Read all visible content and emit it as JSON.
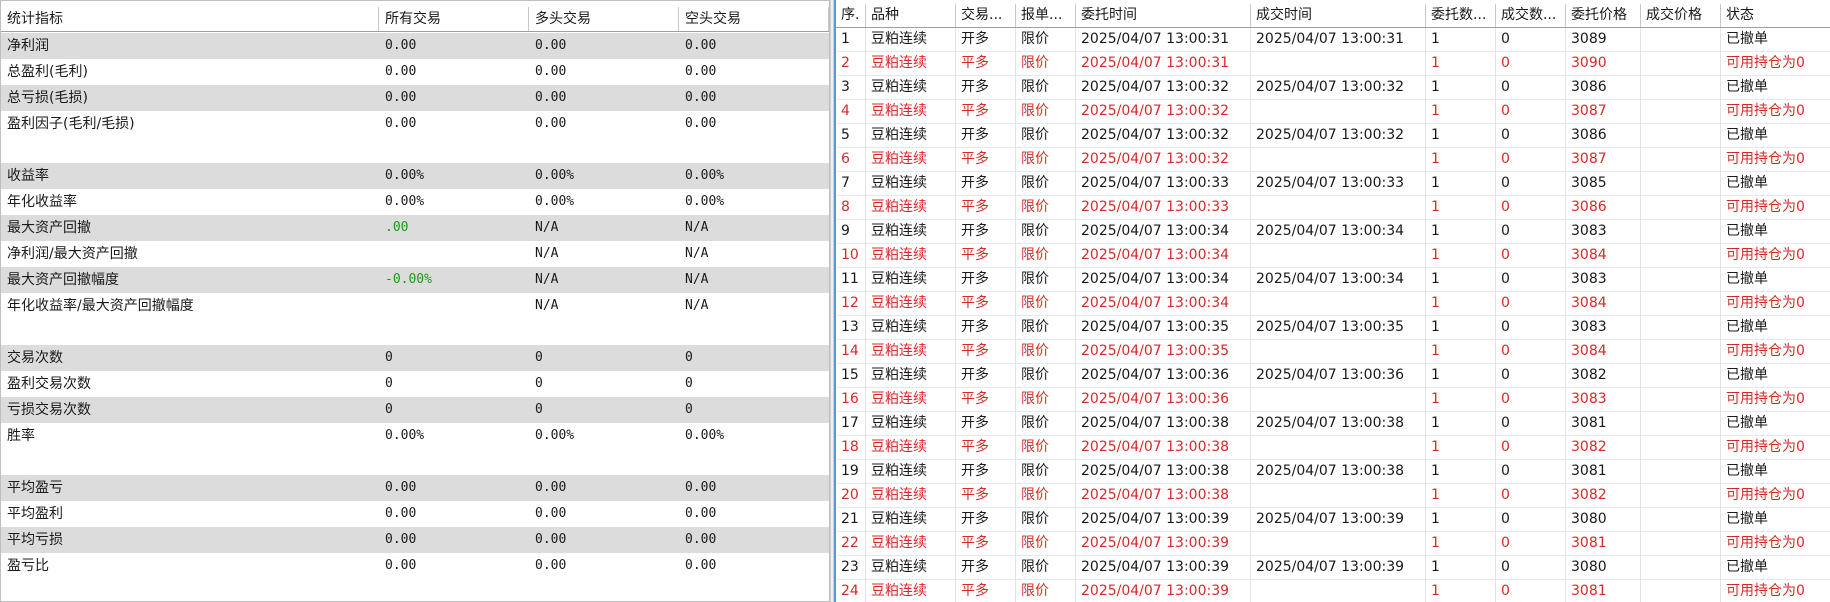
{
  "stats_panel": {
    "headers": [
      "统计指标",
      "所有交易",
      "多头交易",
      "空头交易"
    ],
    "rows": [
      {
        "name": "净利润",
        "all": "0.00",
        "long": "0.00",
        "short": "0.00"
      },
      {
        "name": "总盈利(毛利)",
        "all": "0.00",
        "long": "0.00",
        "short": "0.00"
      },
      {
        "name": "总亏损(毛损)",
        "all": "0.00",
        "long": "0.00",
        "short": "0.00"
      },
      {
        "name": "盈利因子(毛利/毛损)",
        "all": "0.00",
        "long": "0.00",
        "short": "0.00"
      },
      {
        "name": "收益率",
        "all": "0.00%",
        "long": "0.00%",
        "short": "0.00%"
      },
      {
        "name": "年化收益率",
        "all": "0.00%",
        "long": "0.00%",
        "short": "0.00%"
      },
      {
        "name": "最大资产回撤",
        "all": ".00",
        "long": "N/A",
        "short": "N/A",
        "all_color": "#1a9a1a"
      },
      {
        "name": "净利润/最大资产回撤",
        "all": "",
        "long": "N/A",
        "short": "N/A"
      },
      {
        "name": "最大资产回撤幅度",
        "all": "-0.00%",
        "long": "N/A",
        "short": "N/A",
        "all_color": "#1a9a1a"
      },
      {
        "name": "年化收益率/最大资产回撤幅度",
        "all": "",
        "long": "N/A",
        "short": "N/A"
      },
      {
        "name": "交易次数",
        "all": "0",
        "long": "0",
        "short": "0"
      },
      {
        "name": "盈利交易次数",
        "all": "0",
        "long": "0",
        "short": "0"
      },
      {
        "name": "亏损交易次数",
        "all": "0",
        "long": "0",
        "short": "0"
      },
      {
        "name": "胜率",
        "all": "0.00%",
        "long": "0.00%",
        "short": "0.00%"
      },
      {
        "name": "平均盈亏",
        "all": "0.00",
        "long": "0.00",
        "short": "0.00"
      },
      {
        "name": "平均盈利",
        "all": "0.00",
        "long": "0.00",
        "short": "0.00"
      },
      {
        "name": "平均亏损",
        "all": "0.00",
        "long": "0.00",
        "short": "0.00"
      },
      {
        "name": "盈亏比",
        "all": "0.00",
        "long": "0.00",
        "short": "0.00"
      }
    ]
  },
  "orders_panel": {
    "headers": [
      "序.",
      "品种",
      "交易...",
      "报单...",
      "委托时间",
      "成交时间",
      "委托数...",
      "成交数...",
      "委托价格",
      "成交价格",
      "状态"
    ],
    "colors": {
      "normal": "#1a1a1a",
      "highlight": "#d62a2a"
    },
    "rows": [
      {
        "seq": "1",
        "symbol": "豆粕连续",
        "trade": "开多",
        "order_type": "限价",
        "order_time": "2025/04/07 13:00:31",
        "fill_time": "2025/04/07 13:00:31",
        "order_qty": "1",
        "fill_qty": "0",
        "order_price": "3089",
        "fill_price": "",
        "status": "已撤单"
      },
      {
        "seq": "2",
        "symbol": "豆粕连续",
        "trade": "平多",
        "order_type": "限价",
        "order_time": "2025/04/07 13:00:31",
        "fill_time": "",
        "order_qty": "1",
        "fill_qty": "0",
        "order_price": "3090",
        "fill_price": "",
        "status": "可用持仓为0"
      },
      {
        "seq": "3",
        "symbol": "豆粕连续",
        "trade": "开多",
        "order_type": "限价",
        "order_time": "2025/04/07 13:00:32",
        "fill_time": "2025/04/07 13:00:32",
        "order_qty": "1",
        "fill_qty": "0",
        "order_price": "3086",
        "fill_price": "",
        "status": "已撤单"
      },
      {
        "seq": "4",
        "symbol": "豆粕连续",
        "trade": "平多",
        "order_type": "限价",
        "order_time": "2025/04/07 13:00:32",
        "fill_time": "",
        "order_qty": "1",
        "fill_qty": "0",
        "order_price": "3087",
        "fill_price": "",
        "status": "可用持仓为0"
      },
      {
        "seq": "5",
        "symbol": "豆粕连续",
        "trade": "开多",
        "order_type": "限价",
        "order_time": "2025/04/07 13:00:32",
        "fill_time": "2025/04/07 13:00:32",
        "order_qty": "1",
        "fill_qty": "0",
        "order_price": "3086",
        "fill_price": "",
        "status": "已撤单"
      },
      {
        "seq": "6",
        "symbol": "豆粕连续",
        "trade": "平多",
        "order_type": "限价",
        "order_time": "2025/04/07 13:00:32",
        "fill_time": "",
        "order_qty": "1",
        "fill_qty": "0",
        "order_price": "3087",
        "fill_price": "",
        "status": "可用持仓为0"
      },
      {
        "seq": "7",
        "symbol": "豆粕连续",
        "trade": "开多",
        "order_type": "限价",
        "order_time": "2025/04/07 13:00:33",
        "fill_time": "2025/04/07 13:00:33",
        "order_qty": "1",
        "fill_qty": "0",
        "order_price": "3085",
        "fill_price": "",
        "status": "已撤单"
      },
      {
        "seq": "8",
        "symbol": "豆粕连续",
        "trade": "平多",
        "order_type": "限价",
        "order_time": "2025/04/07 13:00:33",
        "fill_time": "",
        "order_qty": "1",
        "fill_qty": "0",
        "order_price": "3086",
        "fill_price": "",
        "status": "可用持仓为0"
      },
      {
        "seq": "9",
        "symbol": "豆粕连续",
        "trade": "开多",
        "order_type": "限价",
        "order_time": "2025/04/07 13:00:34",
        "fill_time": "2025/04/07 13:00:34",
        "order_qty": "1",
        "fill_qty": "0",
        "order_price": "3083",
        "fill_price": "",
        "status": "已撤单"
      },
      {
        "seq": "10",
        "symbol": "豆粕连续",
        "trade": "平多",
        "order_type": "限价",
        "order_time": "2025/04/07 13:00:34",
        "fill_time": "",
        "order_qty": "1",
        "fill_qty": "0",
        "order_price": "3084",
        "fill_price": "",
        "status": "可用持仓为0"
      },
      {
        "seq": "11",
        "symbol": "豆粕连续",
        "trade": "开多",
        "order_type": "限价",
        "order_time": "2025/04/07 13:00:34",
        "fill_time": "2025/04/07 13:00:34",
        "order_qty": "1",
        "fill_qty": "0",
        "order_price": "3083",
        "fill_price": "",
        "status": "已撤单"
      },
      {
        "seq": "12",
        "symbol": "豆粕连续",
        "trade": "平多",
        "order_type": "限价",
        "order_time": "2025/04/07 13:00:34",
        "fill_time": "",
        "order_qty": "1",
        "fill_qty": "0",
        "order_price": "3084",
        "fill_price": "",
        "status": "可用持仓为0"
      },
      {
        "seq": "13",
        "symbol": "豆粕连续",
        "trade": "开多",
        "order_type": "限价",
        "order_time": "2025/04/07 13:00:35",
        "fill_time": "2025/04/07 13:00:35",
        "order_qty": "1",
        "fill_qty": "0",
        "order_price": "3083",
        "fill_price": "",
        "status": "已撤单"
      },
      {
        "seq": "14",
        "symbol": "豆粕连续",
        "trade": "平多",
        "order_type": "限价",
        "order_time": "2025/04/07 13:00:35",
        "fill_time": "",
        "order_qty": "1",
        "fill_qty": "0",
        "order_price": "3084",
        "fill_price": "",
        "status": "可用持仓为0"
      },
      {
        "seq": "15",
        "symbol": "豆粕连续",
        "trade": "开多",
        "order_type": "限价",
        "order_time": "2025/04/07 13:00:36",
        "fill_time": "2025/04/07 13:00:36",
        "order_qty": "1",
        "fill_qty": "0",
        "order_price": "3082",
        "fill_price": "",
        "status": "已撤单"
      },
      {
        "seq": "16",
        "symbol": "豆粕连续",
        "trade": "平多",
        "order_type": "限价",
        "order_time": "2025/04/07 13:00:36",
        "fill_time": "",
        "order_qty": "1",
        "fill_qty": "0",
        "order_price": "3083",
        "fill_price": "",
        "status": "可用持仓为0"
      },
      {
        "seq": "17",
        "symbol": "豆粕连续",
        "trade": "开多",
        "order_type": "限价",
        "order_time": "2025/04/07 13:00:38",
        "fill_time": "2025/04/07 13:00:38",
        "order_qty": "1",
        "fill_qty": "0",
        "order_price": "3081",
        "fill_price": "",
        "status": "已撤单"
      },
      {
        "seq": "18",
        "symbol": "豆粕连续",
        "trade": "平多",
        "order_type": "限价",
        "order_time": "2025/04/07 13:00:38",
        "fill_time": "",
        "order_qty": "1",
        "fill_qty": "0",
        "order_price": "3082",
        "fill_price": "",
        "status": "可用持仓为0"
      },
      {
        "seq": "19",
        "symbol": "豆粕连续",
        "trade": "开多",
        "order_type": "限价",
        "order_time": "2025/04/07 13:00:38",
        "fill_time": "2025/04/07 13:00:38",
        "order_qty": "1",
        "fill_qty": "0",
        "order_price": "3081",
        "fill_price": "",
        "status": "已撤单"
      },
      {
        "seq": "20",
        "symbol": "豆粕连续",
        "trade": "平多",
        "order_type": "限价",
        "order_time": "2025/04/07 13:00:38",
        "fill_time": "",
        "order_qty": "1",
        "fill_qty": "0",
        "order_price": "3082",
        "fill_price": "",
        "status": "可用持仓为0"
      },
      {
        "seq": "21",
        "symbol": "豆粕连续",
        "trade": "开多",
        "order_type": "限价",
        "order_time": "2025/04/07 13:00:39",
        "fill_time": "2025/04/07 13:00:39",
        "order_qty": "1",
        "fill_qty": "0",
        "order_price": "3080",
        "fill_price": "",
        "status": "已撤单"
      },
      {
        "seq": "22",
        "symbol": "豆粕连续",
        "trade": "平多",
        "order_type": "限价",
        "order_time": "2025/04/07 13:00:39",
        "fill_time": "",
        "order_qty": "1",
        "fill_qty": "0",
        "order_price": "3081",
        "fill_price": "",
        "status": "可用持仓为0"
      },
      {
        "seq": "23",
        "symbol": "豆粕连续",
        "trade": "开多",
        "order_type": "限价",
        "order_time": "2025/04/07 13:00:39",
        "fill_time": "2025/04/07 13:00:39",
        "order_qty": "1",
        "fill_qty": "0",
        "order_price": "3080",
        "fill_price": "",
        "status": "已撤单"
      },
      {
        "seq": "24",
        "symbol": "豆粕连续",
        "trade": "平多",
        "order_type": "限价",
        "order_time": "2025/04/07 13:00:39",
        "fill_time": "",
        "order_qty": "1",
        "fill_qty": "0",
        "order_price": "3081",
        "fill_price": "",
        "status": "可用持仓为0"
      }
    ]
  }
}
